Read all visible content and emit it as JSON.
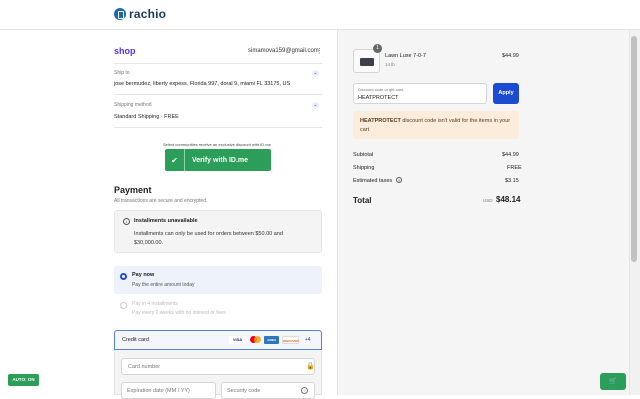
{
  "brand": {
    "name": "rachio"
  },
  "account": {
    "shop_label": "shop",
    "email": "simamova159@gmail.com",
    "menu": "⋮"
  },
  "ship_to": {
    "label": "Ship to",
    "value": "jose bermudez, liberty expess, Florida 997, doral 9, miami FL 33175, US"
  },
  "shipping_method": {
    "label": "Shipping method",
    "value": "Standard Shipping · FREE"
  },
  "idme": {
    "note": "Select communities receive an exclusive discount with ID.me",
    "button": "Verify with ID.me"
  },
  "payment": {
    "title": "Payment",
    "subtitle": "All transactions are secure and encrypted.",
    "installments_title": "Installments unavailable",
    "installments_text": "Installments can only be used for orders between $50.00 and $30,000.00.",
    "pay_now": "Pay now",
    "pay_now_sub": "Pay the entire amount today",
    "pay_in_4": "Pay in 4 installments",
    "pay_in_4_sub": "Pay every 2 weeks with no interest or fees",
    "credit_card": "Credit card",
    "cards": [
      "VISA",
      "MC",
      "AMEX",
      "DISCOVER"
    ],
    "more_cards": "+4",
    "card_number_placeholder": "Card number",
    "expiration_placeholder": "Expiration date (MM / YY)",
    "security_placeholder": "Security code"
  },
  "buttons": {
    "auto": "AUTO: ON"
  },
  "order": {
    "product_name": "Lawn Luxe 7-0-7",
    "product_weight": "14 lb",
    "product_price": "$44.99",
    "quantity": "1",
    "discount_label": "Discount code or gift card",
    "discount_value": "HEATPROTECT",
    "apply": "Apply",
    "warning_code": "HEATPROTECT",
    "warning_text": " discount code isn't valid for the items in your cart",
    "subtotal_label": "Subtotal",
    "subtotal": "$44.99",
    "shipping_label": "Shipping",
    "shipping": "FREE",
    "taxes_label": "Estimated taxes",
    "taxes": "$3.15",
    "total_label": "Total",
    "currency": "USD",
    "total": "$48.14"
  },
  "colors": {
    "accent": "#1b4bd0",
    "shop": "#5a31f4",
    "green": "#2b9e5a",
    "warning_bg": "#fbecdc"
  }
}
